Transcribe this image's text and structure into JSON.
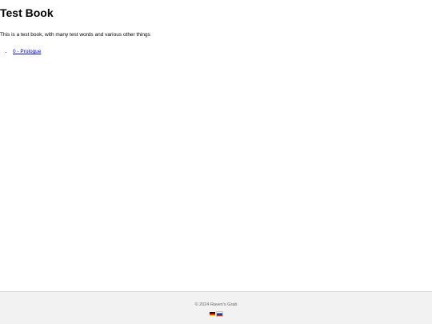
{
  "book": {
    "title": "Test Book",
    "description": "This is a test book, with many test words and various other things",
    "chapters": [
      {
        "label": "0 - Prologue"
      }
    ]
  },
  "footer": {
    "copyright": "© 2024 Raven's Grab",
    "languages": [
      {
        "icon": "german-flag-icon",
        "colors": [
          "#000000",
          "#dd0000",
          "#ffce00"
        ]
      },
      {
        "icon": "russian-flag-icon",
        "colors": [
          "#ffffff",
          "#0039a6",
          "#d52b1e"
        ]
      }
    ]
  },
  "colors": {
    "link": "#0000ee",
    "footer_bg": "#f2f2f2",
    "footer_text": "#666666"
  }
}
